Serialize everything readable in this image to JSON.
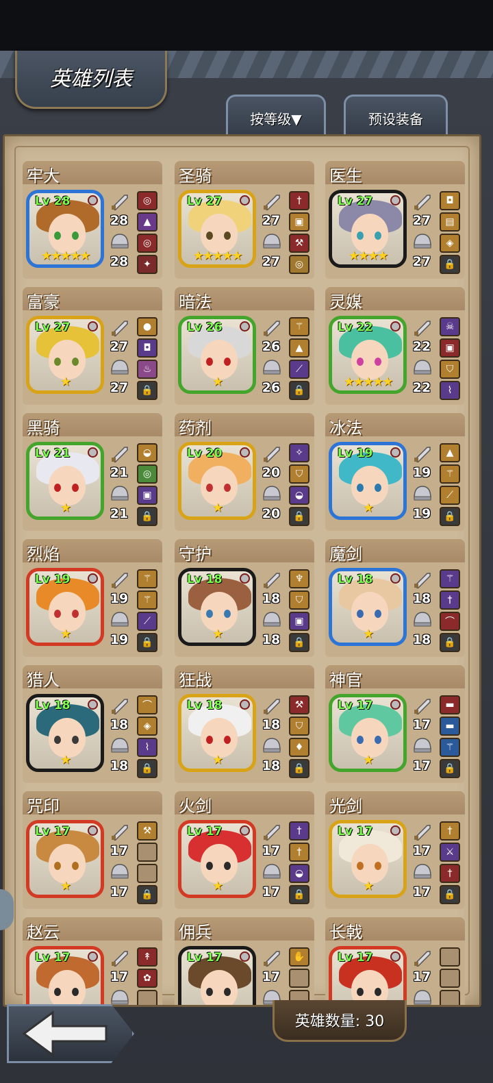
{
  "header": {
    "title": "英雄列表",
    "sort_button": "按等级▼",
    "preset_button": "预设装备"
  },
  "footer": {
    "hero_count": "英雄数量: 30"
  },
  "colors": {
    "level_text": "#7cff4c",
    "star": "#ffd21f",
    "frame_blue": "#2c74d6",
    "frame_green": "#43a52c",
    "frame_gold": "#d9a317",
    "frame_red": "#d33a24",
    "frame_black": "#1a1a1a"
  },
  "heroes": [
    {
      "name": "牢大",
      "level": "Lv 28",
      "stars": "★★★★★",
      "weapon": "28",
      "armor": "28",
      "frame": "#2c74d6",
      "hair": "#b06a2a",
      "eye": "#3a9a3a",
      "slots": [
        "ring",
        "hat",
        "ring",
        "claw"
      ],
      "slot_colors": [
        "#8a2a2a",
        "#6a3a8a",
        "#8a2a2a",
        "#7a2a2a"
      ]
    },
    {
      "name": "圣骑",
      "level": "Lv 27",
      "stars": "★★★★★",
      "weapon": "27",
      "armor": "27",
      "frame": "#d9a317",
      "hair": "#f0d27a",
      "eye": "#5a4a22",
      "slots": [
        "sword",
        "armor",
        "axe",
        "ring"
      ],
      "slot_colors": [
        "#8a2a2a",
        "#b08030",
        "#8a2a2a",
        "#a07830"
      ]
    },
    {
      "name": "医生",
      "level": "Lv 27",
      "stars": "★★★★",
      "weapon": "27",
      "armor": "27",
      "frame": "#1a1a1a",
      "hair": "#8c88a8",
      "eye": "#3aa0b0",
      "slots": [
        "bag",
        "book",
        "amulet",
        "lock"
      ],
      "slot_colors": [
        "#b08030",
        "#b08030",
        "#b08030",
        "#3a3a3a"
      ]
    },
    {
      "name": "富豪",
      "level": "Lv 27",
      "stars": "★",
      "weapon": "27",
      "armor": "27",
      "frame": "#d9a317",
      "hair": "#e6c238",
      "eye": "#6a8a2a",
      "slots": [
        "coin",
        "bag",
        "potion",
        "lock"
      ],
      "slot_colors": [
        "#b08030",
        "#5a3a8a",
        "#8a4a8a",
        "#3a3a3a"
      ]
    },
    {
      "name": "暗法",
      "level": "Lv 26",
      "stars": "★",
      "weapon": "26",
      "armor": "26",
      "frame": "#43a52c",
      "hair": "#d8d8d8",
      "eye": "#c02020",
      "slots": [
        "staff",
        "hat",
        "wand",
        "lock"
      ],
      "slot_colors": [
        "#b08030",
        "#b08030",
        "#5a3a8a",
        "#3a3a3a"
      ]
    },
    {
      "name": "灵媒",
      "level": "Lv 22",
      "stars": "★★★★★",
      "weapon": "22",
      "armor": "22",
      "frame": "#43a52c",
      "hair": "#4ac0a0",
      "eye": "#d040a0",
      "slots": [
        "mask",
        "armor",
        "shield",
        "whip"
      ],
      "slot_colors": [
        "#5a3a8a",
        "#8a2a2a",
        "#b08030",
        "#5a3a8a"
      ]
    },
    {
      "name": "黑骑",
      "level": "Lv 21",
      "stars": "★",
      "weapon": "21",
      "armor": "21",
      "frame": "#43a52c",
      "hair": "#e8e8f0",
      "eye": "#c02020",
      "slots": [
        "helmet",
        "ring",
        "armor",
        "lock"
      ],
      "slot_colors": [
        "#b08030",
        "#4a8a3a",
        "#5a3a8a",
        "#3a3a3a"
      ]
    },
    {
      "name": "药剂",
      "level": "Lv 20",
      "stars": "★",
      "weapon": "20",
      "armor": "20",
      "frame": "#d9a317",
      "hair": "#f0b060",
      "eye": "#c03030",
      "slots": [
        "lamp",
        "shield",
        "helmet",
        "lock"
      ],
      "slot_colors": [
        "#5a3a8a",
        "#b08030",
        "#5a3a8a",
        "#3a3a3a"
      ]
    },
    {
      "name": "冰法",
      "level": "Lv 19",
      "stars": "★",
      "weapon": "19",
      "armor": "19",
      "frame": "#2c74d6",
      "hair": "#40b8c8",
      "eye": "#2a7ab0",
      "slots": [
        "hat",
        "staff",
        "wand",
        "lock"
      ],
      "slot_colors": [
        "#b08030",
        "#b08030",
        "#b08030",
        "#3a3a3a"
      ]
    },
    {
      "name": "烈焰",
      "level": "Lv 19",
      "stars": "★",
      "weapon": "19",
      "armor": "19",
      "frame": "#d33a24",
      "hair": "#e88a28",
      "eye": "#c03030",
      "slots": [
        "staff",
        "staff",
        "wand",
        "lock"
      ],
      "slot_colors": [
        "#b08030",
        "#b08030",
        "#5a3a8a",
        "#3a3a3a"
      ]
    },
    {
      "name": "守护",
      "level": "Lv 18",
      "stars": "★",
      "weapon": "18",
      "armor": "18",
      "frame": "#1a1a1a",
      "hair": "#9a6040",
      "eye": "#3a7ab0",
      "slots": [
        "horn",
        "shield",
        "armor",
        "lock"
      ],
      "slot_colors": [
        "#b08030",
        "#b08030",
        "#5a3a8a",
        "#3a3a3a"
      ]
    },
    {
      "name": "魔剑",
      "level": "Lv 18",
      "stars": "★",
      "weapon": "18",
      "armor": "18",
      "frame": "#2c74d6",
      "hair": "#e8c8a0",
      "eye": "#3a6ab0",
      "slots": [
        "staff",
        "sword",
        "bow",
        "lock"
      ],
      "slot_colors": [
        "#5a3a8a",
        "#5a3a8a",
        "#8a2a2a",
        "#3a3a3a"
      ]
    },
    {
      "name": "猎人",
      "level": "Lv 18",
      "stars": "★",
      "weapon": "18",
      "armor": "18",
      "frame": "#1a1a1a",
      "hair": "#2a6a7a",
      "eye": "#3a3a3a",
      "slots": [
        "bow",
        "amulet",
        "whip",
        "lock"
      ],
      "slot_colors": [
        "#b08030",
        "#b08030",
        "#5a3a8a",
        "#3a3a3a"
      ]
    },
    {
      "name": "狂战",
      "level": "Lv 18",
      "stars": "★",
      "weapon": "18",
      "armor": "18",
      "frame": "#d9a317",
      "hair": "#f0f0f0",
      "eye": "#c02020",
      "slots": [
        "axe",
        "shield",
        "torch",
        "lock"
      ],
      "slot_colors": [
        "#8a2a2a",
        "#b08030",
        "#b08030",
        "#3a3a3a"
      ]
    },
    {
      "name": "神官",
      "level": "Lv 17",
      "stars": "★",
      "weapon": "17",
      "armor": "17",
      "frame": "#43a52c",
      "hair": "#60c8a0",
      "eye": "#3a6ab0",
      "slots": [
        "belt",
        "belt",
        "staff",
        "lock"
      ],
      "slot_colors": [
        "#8a2a2a",
        "#2a5a9a",
        "#2a5a9a",
        "#3a3a3a"
      ]
    },
    {
      "name": "咒印",
      "level": "Lv 17",
      "stars": "★",
      "weapon": "17",
      "armor": "17",
      "frame": "#d33a24",
      "hair": "#c88a40",
      "eye": "#b07020",
      "slots": [
        "axe",
        "",
        "",
        "lock"
      ],
      "slot_colors": [
        "#b08030",
        "#a89070",
        "#a89070",
        "#3a3a3a"
      ]
    },
    {
      "name": "火剑",
      "level": "Lv 17",
      "stars": "★",
      "weapon": "17",
      "armor": "17",
      "frame": "#d33a24",
      "hair": "#d83030",
      "eye": "#2a2a2a",
      "slots": [
        "sword",
        "sword",
        "helmet",
        "lock"
      ],
      "slot_colors": [
        "#5a3a8a",
        "#b08030",
        "#5a3a8a",
        "#3a3a3a"
      ]
    },
    {
      "name": "光剑",
      "level": "Lv 17",
      "stars": "★",
      "weapon": "17",
      "armor": "17",
      "frame": "#d9a317",
      "hair": "#f0e8d8",
      "eye": "#c07020",
      "slots": [
        "sword",
        "dagger",
        "sword",
        "lock"
      ],
      "slot_colors": [
        "#b08030",
        "#5a3a8a",
        "#8a2a2a",
        "#3a3a3a"
      ]
    },
    {
      "name": "赵云",
      "level": "Lv 17",
      "stars": "",
      "weapon": "17",
      "armor": "",
      "frame": "#d33a24",
      "hair": "#c06a30",
      "eye": "#2a2a2a",
      "slots": [
        "spear",
        "flower",
        "",
        ""
      ],
      "slot_colors": [
        "#8a2a2a",
        "#8a2a2a",
        "#a89070",
        "#a89070"
      ]
    },
    {
      "name": "佣兵",
      "level": "Lv 17",
      "stars": "",
      "weapon": "17",
      "armor": "",
      "frame": "#1a1a1a",
      "hair": "#6a4a2a",
      "eye": "#2a2a2a",
      "slots": [
        "glove",
        "",
        "",
        ""
      ],
      "slot_colors": [
        "#b08030",
        "#a89070",
        "#a89070",
        "#a89070"
      ]
    },
    {
      "name": "长戟",
      "level": "Lv 17",
      "stars": "",
      "weapon": "17",
      "armor": "",
      "frame": "#d33a24",
      "hair": "#c83020",
      "eye": "#2a2a2a",
      "slots": [
        "",
        "",
        "",
        ""
      ],
      "slot_colors": [
        "#a89070",
        "#a89070",
        "#a89070",
        "#a89070"
      ]
    }
  ]
}
